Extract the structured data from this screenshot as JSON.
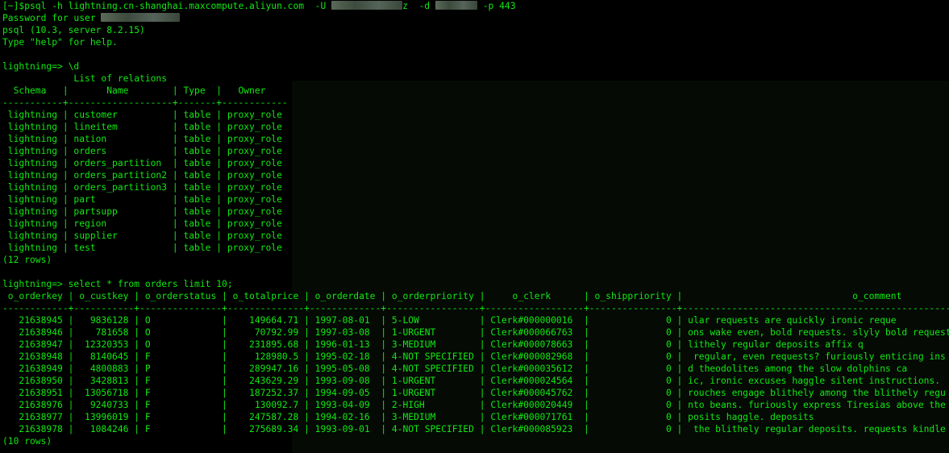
{
  "window": {
    "type": "terminal",
    "fg_color": "#11e811",
    "bg_color": "#000000"
  },
  "session": {
    "cmd_prefix": "[~]$psql -h lightning.cn-shanghai.maxcompute.aliyun.com  -U ",
    "cmd_mid1": "z  -d ",
    "cmd_mid2": " -p 443",
    "password_prompt": "Password for user ",
    "version_line": "psql (10.3, server 8.2.15)",
    "help_line": "Type \"help\" for help."
  },
  "relations": {
    "prompt": "lightning=> \\d",
    "title": "             List of relations",
    "header": "  Schema   |       Name        | Type  |   Owner",
    "divider": "-----------+-------------------+-------+------------",
    "rows": [
      " lightning | customer          | table | proxy_role",
      " lightning | lineitem          | table | proxy_role",
      " lightning | nation            | table | proxy_role",
      " lightning | orders            | table | proxy_role",
      " lightning | orders_partition  | table | proxy_role",
      " lightning | orders_partition2 | table | proxy_role",
      " lightning | orders_partition3 | table | proxy_role",
      " lightning | part              | table | proxy_role",
      " lightning | partsupp          | table | proxy_role",
      " lightning | region            | table | proxy_role",
      " lightning | supplier          | table | proxy_role",
      " lightning | test              | table | proxy_role"
    ],
    "count": "(12 rows)"
  },
  "orders_query": {
    "prompt": "lightning=> select * from orders limit 10;",
    "header": " o_orderkey | o_custkey | o_orderstatus | o_totalprice | o_orderdate | o_orderpriority |     o_clerk      | o_shippriority |                               o_comment",
    "divider": "------------+-----------+---------------+--------------+-------------+-----------------+------------------+----------------+---------------------------------------------------------------------------",
    "rows": [
      "   21638945 |   9836128 | O             |    149664.71 | 1997-08-01  | 5-LOW           | Clerk#000000016  |              0 | ular requests are quickly ironic reque",
      "   21638946 |    781658 | O             |     70792.99 | 1997-03-08  | 1-URGENT        | Clerk#000066763  |              0 | ons wake even, bold requests. slyly bold requests snooze slyly fin",
      "   21638947 |  12320353 | O             |    231895.68 | 1996-01-13  | 3-MEDIUM        | Clerk#000078663  |              0 | lithely regular deposits affix q",
      "   21638948 |   8140645 | F             |     128980.5 | 1995-02-18  | 4-NOT SPECIFIED | Clerk#000082968  |              0 |  regular, even requests? furiously enticing ins",
      "   21638949 |   4800883 | P             |    289947.16 | 1995-05-08  | 4-NOT SPECIFIED | Clerk#000035612  |              0 | d theodolites among the slow dolphins ca",
      "   21638950 |   3428813 | F             |    243629.29 | 1993-09-08  | 1-URGENT        | Clerk#000024564  |              0 | ic, ironic excuses haggle silent instructions.",
      "   21638951 |  13056718 | F             |    187252.37 | 1994-09-05  | 1-URGENT        | Clerk#000045762  |              0 | rouches engage blithely among the blithely regu",
      "   21638976 |   9240733 | F             |     130092.7 | 1993-04-09  | 2-HIGH          | Clerk#000020449  |              0 | nto beans. furiously express Tiresias above the regular a",
      "   21638977 |  13996019 | F             |    247587.28 | 1994-02-16  | 3-MEDIUM        | Clerk#000071761  |              0 | posits haggle. deposits",
      "   21638978 |   1084246 | F             |    275689.34 | 1993-09-01  | 4-NOT SPECIFIED | Clerk#000085923  |              0 |  the blithely regular deposits. requests kindle fluffily. ideas nag s"
    ],
    "count": "(10 rows)"
  }
}
